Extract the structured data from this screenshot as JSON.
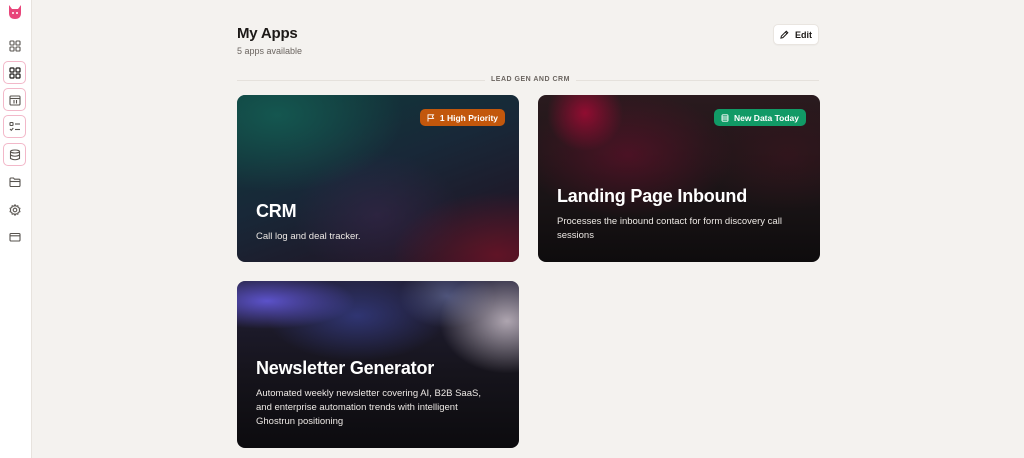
{
  "header": {
    "title": "My Apps",
    "subtitle": "5 apps available",
    "edit_label": "Edit"
  },
  "section": {
    "label": "LEAD GEN AND CRM"
  },
  "cards": [
    {
      "title": "CRM",
      "description": "Call log and deal tracker.",
      "badge": "1 High Priority",
      "badge_color": "#c2570c"
    },
    {
      "title": "Landing Page Inbound",
      "description": "Processes the inbound contact for form discovery call sessions",
      "badge": "New Data Today",
      "badge_color": "#119a66"
    },
    {
      "title": "Newsletter Generator",
      "description": "Automated weekly newsletter covering AI, B2B SaaS, and enterprise automation trends with intelligent Ghostrun positioning"
    }
  ],
  "sidebar": {
    "logo_icon": "fox-logo-icon",
    "accent": "#e8457a",
    "items": [
      {
        "icon": "dashboard-icon"
      },
      {
        "icon": "apps-grid-icon",
        "active": true
      },
      {
        "icon": "calendar-icon",
        "active": true
      },
      {
        "icon": "checklist-icon",
        "active": true
      },
      {
        "icon": "database-icon",
        "active": true
      },
      {
        "icon": "folder-icon"
      },
      {
        "icon": "gear-icon"
      },
      {
        "icon": "credit-card-icon"
      }
    ]
  }
}
